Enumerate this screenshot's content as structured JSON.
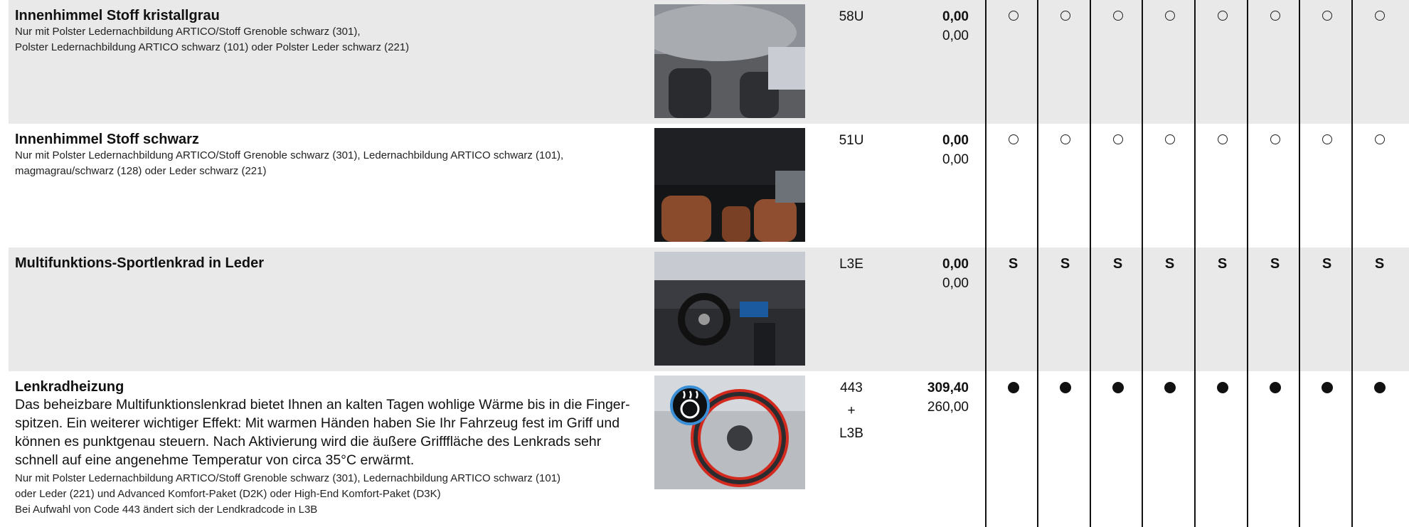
{
  "rows": [
    {
      "title": "Innenhimmel Stoff kristallgrau",
      "notes": [
        "Nur mit Polster Ledernachbildung ARTICO/Stoff Grenoble schwarz (301),",
        "Polster Ledernachbildung ARTICO schwarz (101) oder Polster Leder schwarz (221)"
      ],
      "image_icon": "grey-headliner-interior-photo",
      "code_lines": [
        "58U"
      ],
      "price_gross": "0,00",
      "price_net": "0,00",
      "mark_type": "circle",
      "mark_label": "",
      "shaded": true
    },
    {
      "title": "Innenhimmel Stoff schwarz",
      "notes": [
        "Nur mit Polster Ledernachbildung ARTICO/Stoff Grenoble schwarz (301), Ledernachbildung ARTICO schwarz (101),",
        "magmagrau/schwarz (128) oder Leder schwarz (221)"
      ],
      "image_icon": "black-headliner-interior-photo",
      "code_lines": [
        "51U"
      ],
      "price_gross": "0,00",
      "price_net": "0,00",
      "mark_type": "circle",
      "mark_label": "",
      "shaded": false
    },
    {
      "title": "Multifunktions-Sportlenkrad in Leder",
      "notes": [],
      "image_icon": "cockpit-interior-photo",
      "code_lines": [
        "L3E"
      ],
      "price_gross": "0,00",
      "price_net": "0,00",
      "mark_type": "std",
      "mark_label": "S",
      "shaded": true
    },
    {
      "title": "Lenkradheizung",
      "description": [
        "Das beheizbare Multifunktionslenkrad bietet Ihnen an kalten Tagen wohlige Wärme bis in die Finger-",
        "spitzen. Ein weiterer wichtiger Effekt: Mit warmen Händen haben Sie Ihr Fahrzeug fest im Griff und",
        "können es punktgenau steuern. Nach Aktivierung wird die äußere Grifffläche des Lenkrads sehr",
        "schnell auf eine angenehme Temperatur von circa 35°C erwärmt."
      ],
      "notes": [
        "Nur mit Polster Ledernachbildung ARTICO/Stoff Grenoble schwarz (301), Ledernachbildung ARTICO schwarz (101)",
        "oder Leder (221) und Advanced Komfort-Paket (D2K) oder High-End Komfort-Paket (D3K)",
        "Bei Aufwahl von Code 443 ändert sich der Lendkradcode in L3B"
      ],
      "image_icon": "heated-steering-wheel-photo",
      "code_lines": [
        "443",
        "+",
        "L3B"
      ],
      "price_gross": "309,40",
      "price_net": "260,00",
      "mark_type": "dot",
      "mark_label": "",
      "shaded": false
    }
  ],
  "columns": [
    {
      "name": "variant-1"
    },
    {
      "name": "variant-2"
    },
    {
      "name": "variant-3"
    },
    {
      "name": "variant-4"
    },
    {
      "name": "variant-5"
    },
    {
      "name": "variant-6"
    },
    {
      "name": "variant-7"
    },
    {
      "name": "variant-8"
    }
  ],
  "colors": {
    "row_shade": "#e9e9e9",
    "rule": "#111111",
    "text": "#111111"
  }
}
